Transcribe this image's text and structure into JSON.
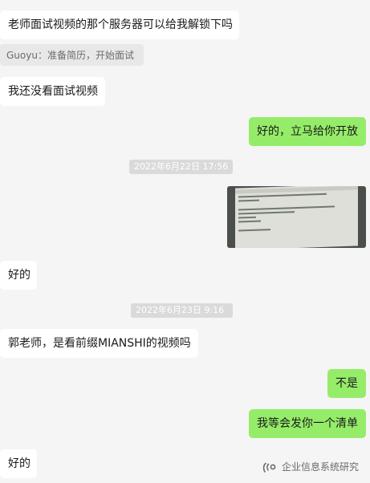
{
  "messages": [
    {
      "text": "老师面试视频的那个服务器可以给我解锁下吗"
    },
    {
      "quote": "Guoyu：准备简历，开始面试"
    },
    {
      "text": "我还没看面试视频"
    },
    {
      "text": "好的，立马给你开放"
    },
    {
      "time": "2022年6月22日 17:56"
    },
    {
      "text": "好的"
    },
    {
      "time": "2022年6月23日 9:16"
    },
    {
      "text": "郭老师，是看前缀MIANSHI的视频吗"
    },
    {
      "text": "不是"
    },
    {
      "text": "我等会发你一个清单"
    },
    {
      "text": "好的"
    }
  ],
  "watermark": {
    "icon": "wechat-official-account-icon",
    "text": "企业信息系统研究"
  }
}
